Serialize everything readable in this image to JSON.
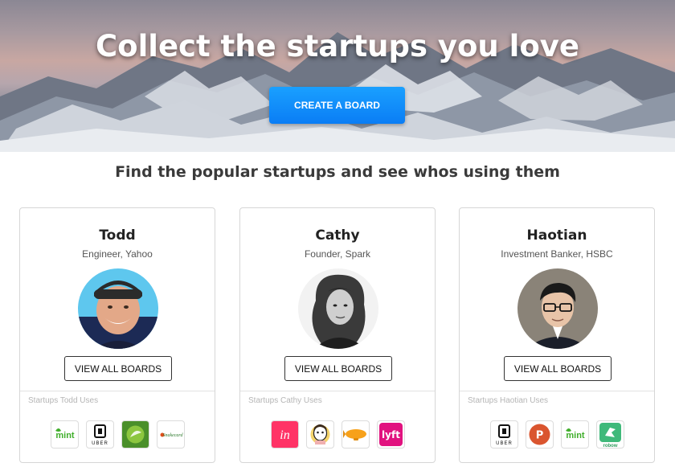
{
  "hero": {
    "title": "Collect the startups you love",
    "cta_label": "CREATE A BOARD"
  },
  "section": {
    "title": "Find the popular startups and see whos using them"
  },
  "cards": [
    {
      "name": "Todd",
      "role": "Engineer, Yahoo",
      "button_label": "VIEW ALL BOARDS",
      "uses_label": "Startups Todd Uses",
      "logos": [
        {
          "icon": "mint-logo-icon",
          "text": "mint"
        },
        {
          "icon": "uber-logo-icon",
          "text": "UBER"
        },
        {
          "icon": "hello-fresh-logo-icon",
          "text": "HelloFresh"
        },
        {
          "icon": "snakecard-logo-icon",
          "text": "Snakecard"
        }
      ]
    },
    {
      "name": "Cathy",
      "role": "Founder, Spark",
      "button_label": "VIEW ALL BOARDS",
      "uses_label": "Startups Cathy Uses",
      "logos": [
        {
          "icon": "invision-logo-icon",
          "text": "in"
        },
        {
          "icon": "mailchimp-logo-icon",
          "text": ""
        },
        {
          "icon": "blimp-logo-icon",
          "text": ""
        },
        {
          "icon": "lyft-logo-icon",
          "text": "lyft"
        }
      ]
    },
    {
      "name": "Haotian",
      "role": "Investment Banker, HSBC",
      "button_label": "VIEW ALL BOARDS",
      "uses_label": "Startups Haotian Uses",
      "logos": [
        {
          "icon": "uber-logo-icon",
          "text": "UBER"
        },
        {
          "icon": "producthunt-logo-icon",
          "text": "P"
        },
        {
          "icon": "mint-logo-icon",
          "text": "mint"
        },
        {
          "icon": "robinhood-logo-icon",
          "text": "robow"
        }
      ]
    }
  ],
  "colors": {
    "cta_blue": "#0a7df5",
    "invision_pink": "#ff3366",
    "lyft_pink": "#e1127f",
    "producthunt_orange": "#da552f",
    "mint_green": "#3fae2a"
  }
}
